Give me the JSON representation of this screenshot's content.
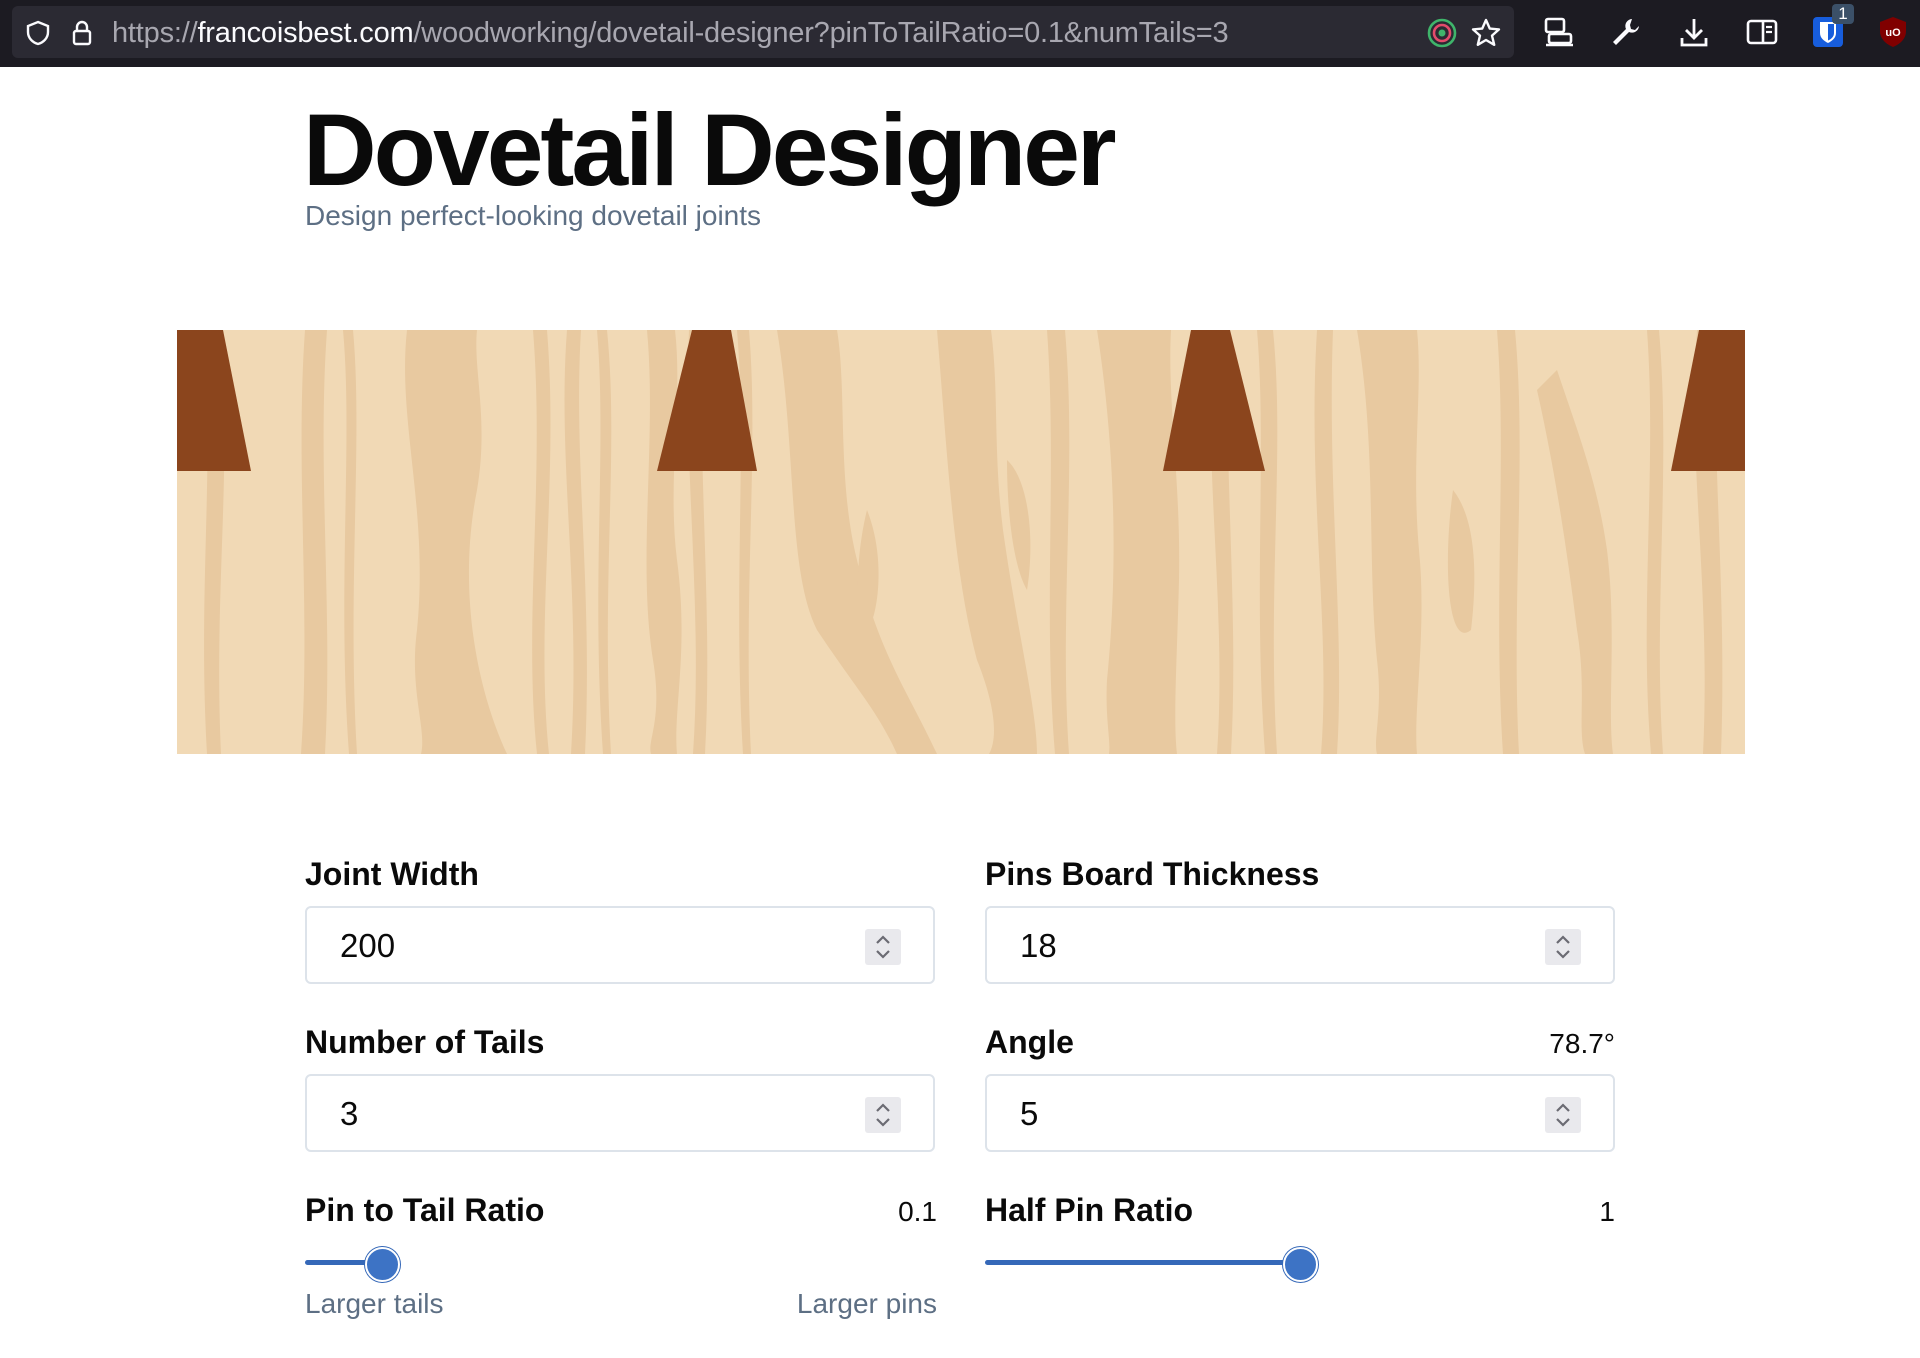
{
  "browser": {
    "url_scheme": "https://",
    "url_host": "francoisbest.com",
    "url_path": "/woodworking/dovetail-designer?pinToTailRatio=0.1&numTails=3",
    "extension_badge": "1",
    "icons": [
      "shield-icon",
      "lock-icon",
      "target-icon",
      "star-icon",
      "devices-icon",
      "wrench-icon",
      "download-icon",
      "reader-icon",
      "bitwarden-icon",
      "ublock-icon"
    ]
  },
  "header": {
    "title": "Dovetail Designer",
    "subtitle": "Design perfect-looking dovetail joints"
  },
  "visual": {
    "wood_light": "#f1d9b5",
    "wood_grain": "#e8c9a0",
    "pin_color": "#8b451d",
    "num_pins_visible": 4
  },
  "form": {
    "joint_width": {
      "label": "Joint Width",
      "value": "200"
    },
    "pins_board_thickness": {
      "label": "Pins Board Thickness",
      "value": "18"
    },
    "number_of_tails": {
      "label": "Number of Tails",
      "value": "3"
    },
    "angle": {
      "label": "Angle",
      "readout": "78.7°",
      "value": "5"
    },
    "pin_to_tail_ratio": {
      "label": "Pin to Tail Ratio",
      "readout": "0.1",
      "fraction": 0.1,
      "hint_left": "Larger tails",
      "hint_right": "Larger pins"
    },
    "half_pin_ratio": {
      "label": "Half Pin Ratio",
      "readout": "1",
      "fraction": 0.5
    }
  },
  "colors": {
    "accent": "#3568b8",
    "muted_text": "#5d6f84"
  }
}
